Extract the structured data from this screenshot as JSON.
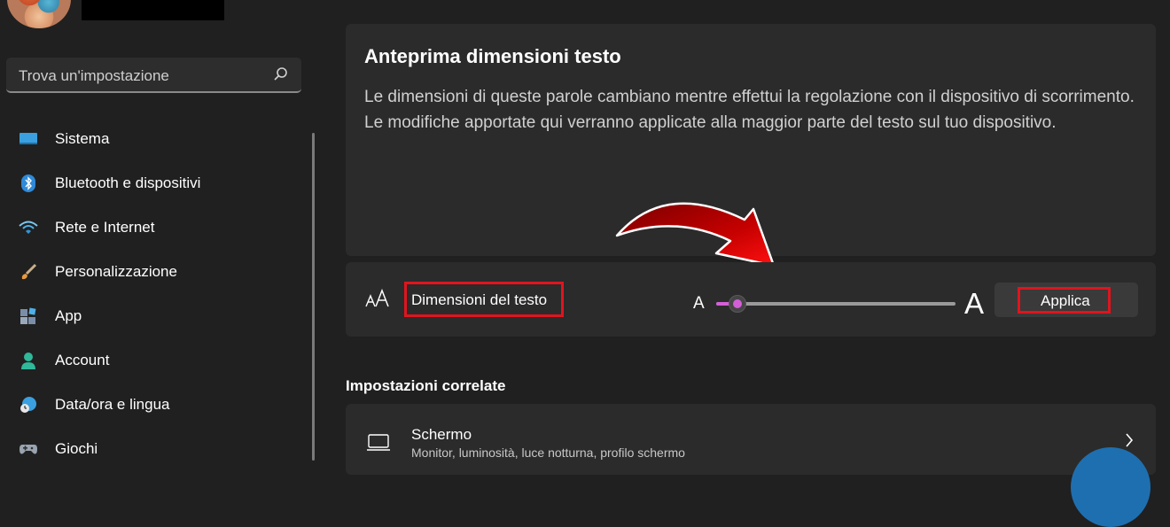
{
  "search": {
    "placeholder": "Trova un'impostazione"
  },
  "sidebar": {
    "items": [
      {
        "label": "Sistema",
        "icon": "monitor-icon"
      },
      {
        "label": "Bluetooth e dispositivi",
        "icon": "bluetooth-icon"
      },
      {
        "label": "Rete e Internet",
        "icon": "wifi-icon"
      },
      {
        "label": "Personalizzazione",
        "icon": "brush-icon"
      },
      {
        "label": "App",
        "icon": "apps-icon"
      },
      {
        "label": "Account",
        "icon": "person-icon"
      },
      {
        "label": "Data/ora e lingua",
        "icon": "globe-clock-icon"
      },
      {
        "label": "Giochi",
        "icon": "gamepad-icon"
      }
    ]
  },
  "preview": {
    "title": "Anteprima dimensioni testo",
    "body": "Le dimensioni di queste parole cambiano mentre effettui la regolazione con il dispositivo di scorrimento. Le modifiche apportate qui verranno applicate alla maggior parte del testo sul tuo dispositivo."
  },
  "text_size": {
    "label": "Dimensioni del testo",
    "small_a": "A",
    "big_a": "A",
    "slider_value_fraction": 0.05,
    "apply_label": "Applica"
  },
  "related": {
    "heading": "Impostazioni correlate",
    "screen_title": "Schermo",
    "screen_subtitle": "Monitor, luminosità, luce notturna, profilo schermo"
  },
  "colors": {
    "accent": "#d35fd8",
    "highlight_box": "#e0141e",
    "background": "#202020",
    "card": "#2b2b2b"
  }
}
